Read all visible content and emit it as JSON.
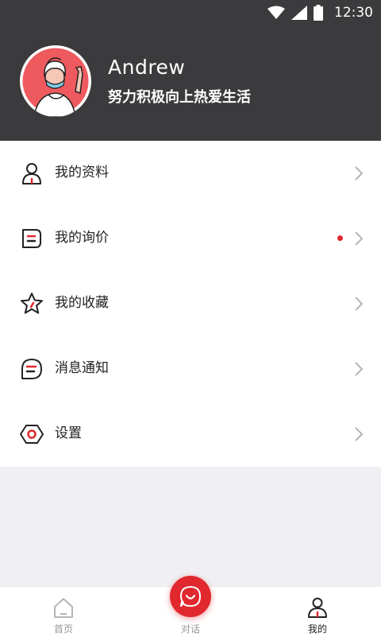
{
  "status_bar": {
    "time": "12:30",
    "icons": [
      "wifi-icon",
      "cell-signal-icon",
      "battery-icon"
    ]
  },
  "profile": {
    "name": "Andrew",
    "bio": "努力积极向上热爱生活",
    "avatar": "avatar-illustration"
  },
  "menu": {
    "items": [
      {
        "label": "我的资料",
        "icon": "user-icon",
        "badge": false
      },
      {
        "label": "我的询价",
        "icon": "inquiry-icon",
        "badge": true
      },
      {
        "label": "我的收藏",
        "icon": "star-icon",
        "badge": false
      },
      {
        "label": "消息通知",
        "icon": "message-icon",
        "badge": false
      },
      {
        "label": "设置",
        "icon": "settings-icon",
        "badge": false
      }
    ]
  },
  "tabbar": {
    "items": [
      {
        "label": "首页",
        "icon": "home-icon",
        "active": false
      },
      {
        "label": "对话",
        "icon": "chat-icon",
        "active": false
      },
      {
        "label": "我的",
        "icon": "user-icon",
        "active": true
      }
    ]
  },
  "colors": {
    "header_bg": "#3b3a3c",
    "accent": "#e0282e",
    "background": "#f0f0f4"
  }
}
